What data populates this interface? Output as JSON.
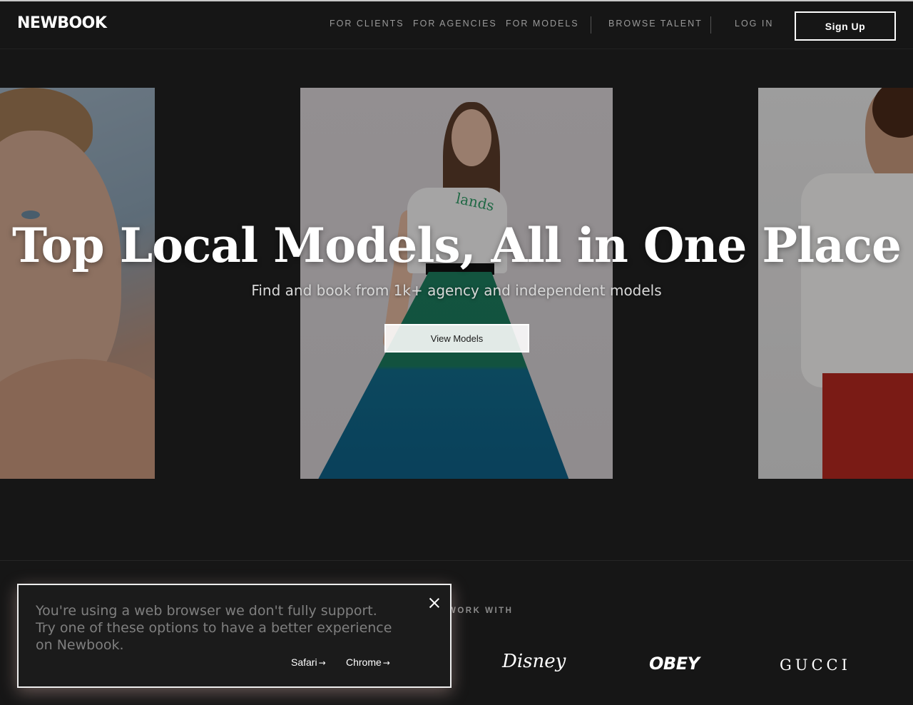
{
  "header": {
    "logo": "NEWBOOK",
    "nav": [
      {
        "label": "FOR CLIENTS"
      },
      {
        "label": "FOR AGENCIES"
      },
      {
        "label": "FOR MODELS"
      },
      {
        "label": "BROWSE TALENT"
      },
      {
        "label": "LOG IN"
      }
    ],
    "signup_label": "Sign Up"
  },
  "hero": {
    "title": "Top Local Models, All in One Place",
    "subtitle": "Find and book from 1k+ agency and independent models",
    "cta_label": "View Models",
    "center_shirt_text": "lands"
  },
  "brands": {
    "heading": "WORK WITH",
    "logos": [
      "Disney",
      "OBEY",
      "GUCCI"
    ]
  },
  "browser_notice": {
    "message": "You're using a web browser we don't fully support. Try one of these options to have a better experience on Newbook.",
    "links": [
      {
        "label": "Safari",
        "arrow": "→"
      },
      {
        "label": "Chrome",
        "arrow": "→"
      }
    ]
  },
  "colors": {
    "background": "#161616",
    "text_muted": "#9a9a9a"
  }
}
